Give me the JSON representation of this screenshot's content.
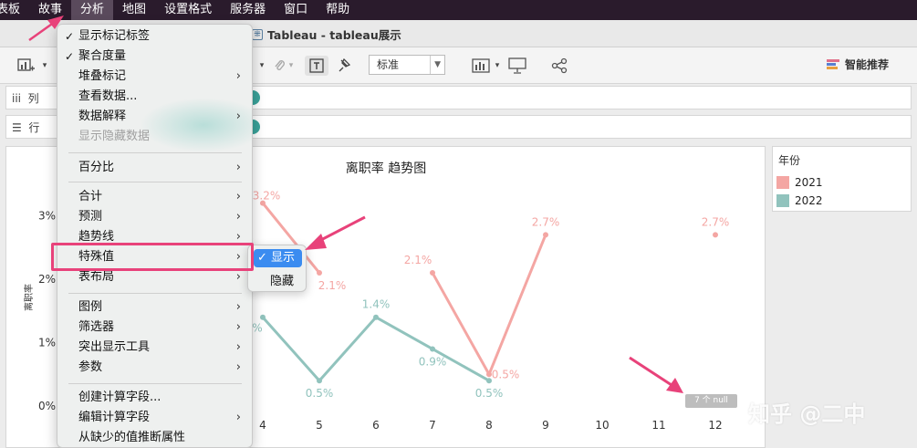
{
  "menubar": {
    "items": [
      "表板",
      "故事",
      "分析",
      "地图",
      "设置格式",
      "服务器",
      "窗口",
      "帮助"
    ]
  },
  "window": {
    "title": "Tableau - tableau展示"
  },
  "toolbar": {
    "dropdown_value": "标准",
    "smart_label": "智能推荐"
  },
  "shelves": {
    "columns_label": "列",
    "rows_label": "行"
  },
  "analysis_menu": {
    "items": [
      {
        "label": "显示标记标签",
        "checked": true
      },
      {
        "label": "聚合度量",
        "checked": true
      },
      {
        "label": "堆叠标记",
        "submenu": true
      },
      {
        "label": "查看数据..."
      },
      {
        "label": "数据解释",
        "submenu": true
      },
      {
        "label": "显示隐藏数据",
        "disabled": true
      },
      {
        "label": "百分比",
        "submenu": true
      },
      {
        "label": "合计",
        "submenu": true
      },
      {
        "label": "预测",
        "submenu": true
      },
      {
        "label": "趋势线",
        "submenu": true
      },
      {
        "label": "特殊值",
        "submenu": true
      },
      {
        "label": "表布局",
        "submenu": true
      },
      {
        "label": "图例",
        "submenu": true
      },
      {
        "label": "筛选器",
        "submenu": true
      },
      {
        "label": "突出显示工具",
        "submenu": true
      },
      {
        "label": "参数",
        "submenu": true
      },
      {
        "label": "创建计算字段..."
      },
      {
        "label": "编辑计算字段",
        "submenu": true
      },
      {
        "label": "从缺少的值推断属性"
      }
    ],
    "check_mark": "✓",
    "arrow": "›"
  },
  "special_values_submenu": {
    "show": "显示",
    "hide": "隐藏",
    "check_mark": "✓"
  },
  "legend": {
    "title": "年份",
    "items": [
      {
        "label": "2021",
        "color": "#f4a6a3"
      },
      {
        "label": "2022",
        "color": "#91c3bd"
      }
    ]
  },
  "null_badge": "7 个 null",
  "watermark": "知乎 @二中",
  "chart_data": {
    "type": "line",
    "title": "离职率 趋势图",
    "ylabel": "离职率",
    "y_ticks": [
      "0%",
      "1%",
      "2%",
      "3%"
    ],
    "x_ticks": [
      "4",
      "5",
      "6",
      "7",
      "8",
      "9",
      "10",
      "11",
      "12"
    ],
    "series": [
      {
        "name": "2021",
        "color": "#f4a6a3",
        "points": [
          {
            "x": 4,
            "y": 3.2,
            "label": "3.2%"
          },
          {
            "x": 5,
            "y": 2.1,
            "label": "2.1%"
          }
        ],
        "segment2": [
          {
            "x": 7,
            "y": 2.1,
            "label": "2.1%"
          },
          {
            "x": 8,
            "y": 0.5,
            "label": "0.5%"
          },
          {
            "x": 9,
            "y": 2.7,
            "label": "2.7%"
          }
        ],
        "isolated": [
          {
            "x": 12,
            "y": 2.7,
            "label": "2.7%"
          }
        ]
      },
      {
        "name": "2022",
        "color": "#91c3bd",
        "points": [
          {
            "x": 4,
            "y": 1.4,
            "label": "%"
          },
          {
            "x": 5,
            "y": 0.4,
            "label": "0.5%"
          },
          {
            "x": 6,
            "y": 1.4,
            "label": "1.4%"
          },
          {
            "x": 7,
            "y": 0.9,
            "label": "0.9%"
          },
          {
            "x": 8,
            "y": 0.4,
            "label": "0.5%"
          }
        ]
      }
    ]
  }
}
